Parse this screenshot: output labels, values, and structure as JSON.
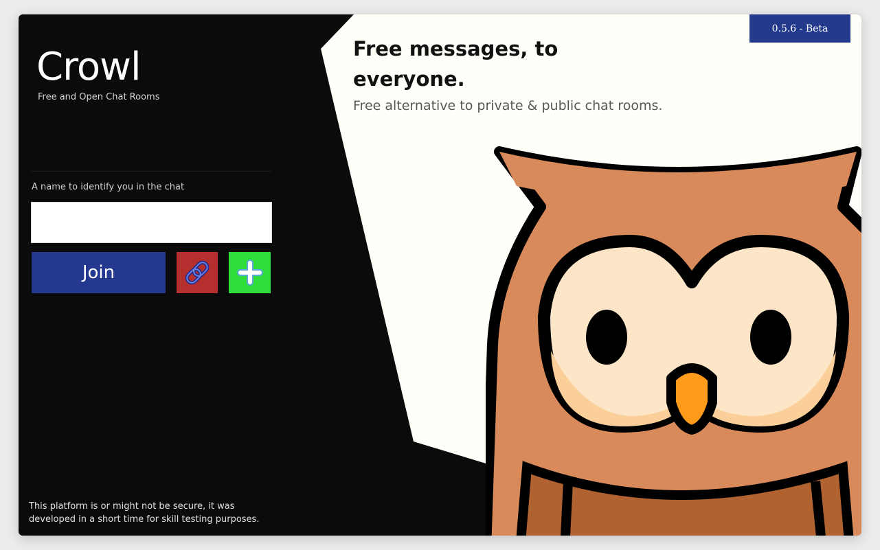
{
  "brand": {
    "title": "Crowl",
    "subtitle": "Free and Open Chat Rooms"
  },
  "login": {
    "name_label": "A name to identify you in the chat",
    "name_value": "",
    "join_label": "Join",
    "link_icon": "link-icon",
    "create_icon": "plus-icon"
  },
  "disclaimer": "This platform is or might not be secure, it was developed in a short time for skill testing purposes.",
  "hero": {
    "heading": "Free messages, to everyone.",
    "subheading": "Free alternative to private & public chat rooms."
  },
  "version": "0.5.6 - Beta",
  "colors": {
    "panel": "#0b0b0b",
    "hero": "#fffff9",
    "join": "#25388f",
    "link": "#b52f2f",
    "create": "#2fde3c",
    "badge": "#243a8c"
  }
}
